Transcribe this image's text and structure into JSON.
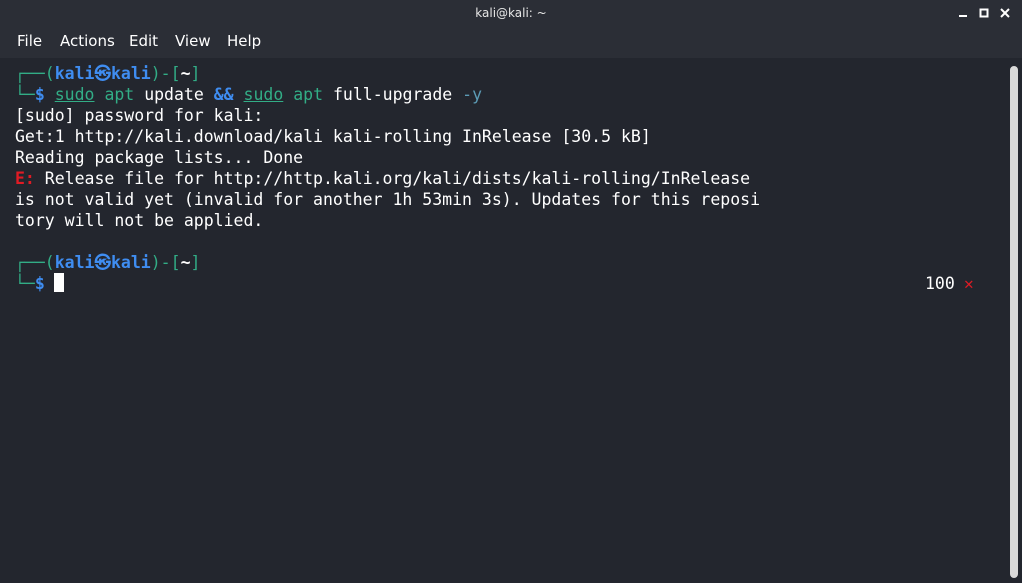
{
  "window": {
    "title": "kali@kali: ~",
    "buttons": [
      "minimize",
      "maximize",
      "close"
    ]
  },
  "menubar": {
    "items": [
      "File",
      "Actions",
      "Edit",
      "View",
      "Help"
    ]
  },
  "terminal": {
    "prompt1": {
      "open": "┌──(",
      "user": "kali",
      "at": "㉿",
      "host": "kali",
      "mid": ")-[",
      "dir": "~",
      "close": "]",
      "lead": "└─",
      "dollar": "$"
    },
    "command": {
      "sudo1": "sudo",
      "apt1": "apt",
      "update": "update",
      "and": "&&",
      "sudo2": "sudo",
      "apt2": "apt",
      "fullupgrade": "full-upgrade",
      "flag": "-y"
    },
    "output": [
      "[sudo] password for kali:",
      "Get:1 http://kali.download/kali kali-rolling InRelease [30.5 kB]",
      "Reading package lists... Done"
    ],
    "error": {
      "prefix": "E:",
      "line1": " Release file for http://http.kali.org/kali/dists/kali-rolling/InRelease",
      "line2": "is not valid yet (invalid for another 1h 53min 3s). Updates for this reposi",
      "line3": "tory will not be applied."
    },
    "prompt2": {
      "open": "┌──(",
      "user": "kali",
      "at": "㉿",
      "host": "kali",
      "mid": ")-[",
      "dir": "~",
      "close": "]",
      "lead": "└─",
      "dollar": "$"
    },
    "exit_status": "100",
    "exit_mark": "✕"
  },
  "colors": {
    "background": "#23262e",
    "prompt_green": "#32ad86",
    "prompt_blue": "#3f8df1",
    "error_red": "#e01b24"
  }
}
